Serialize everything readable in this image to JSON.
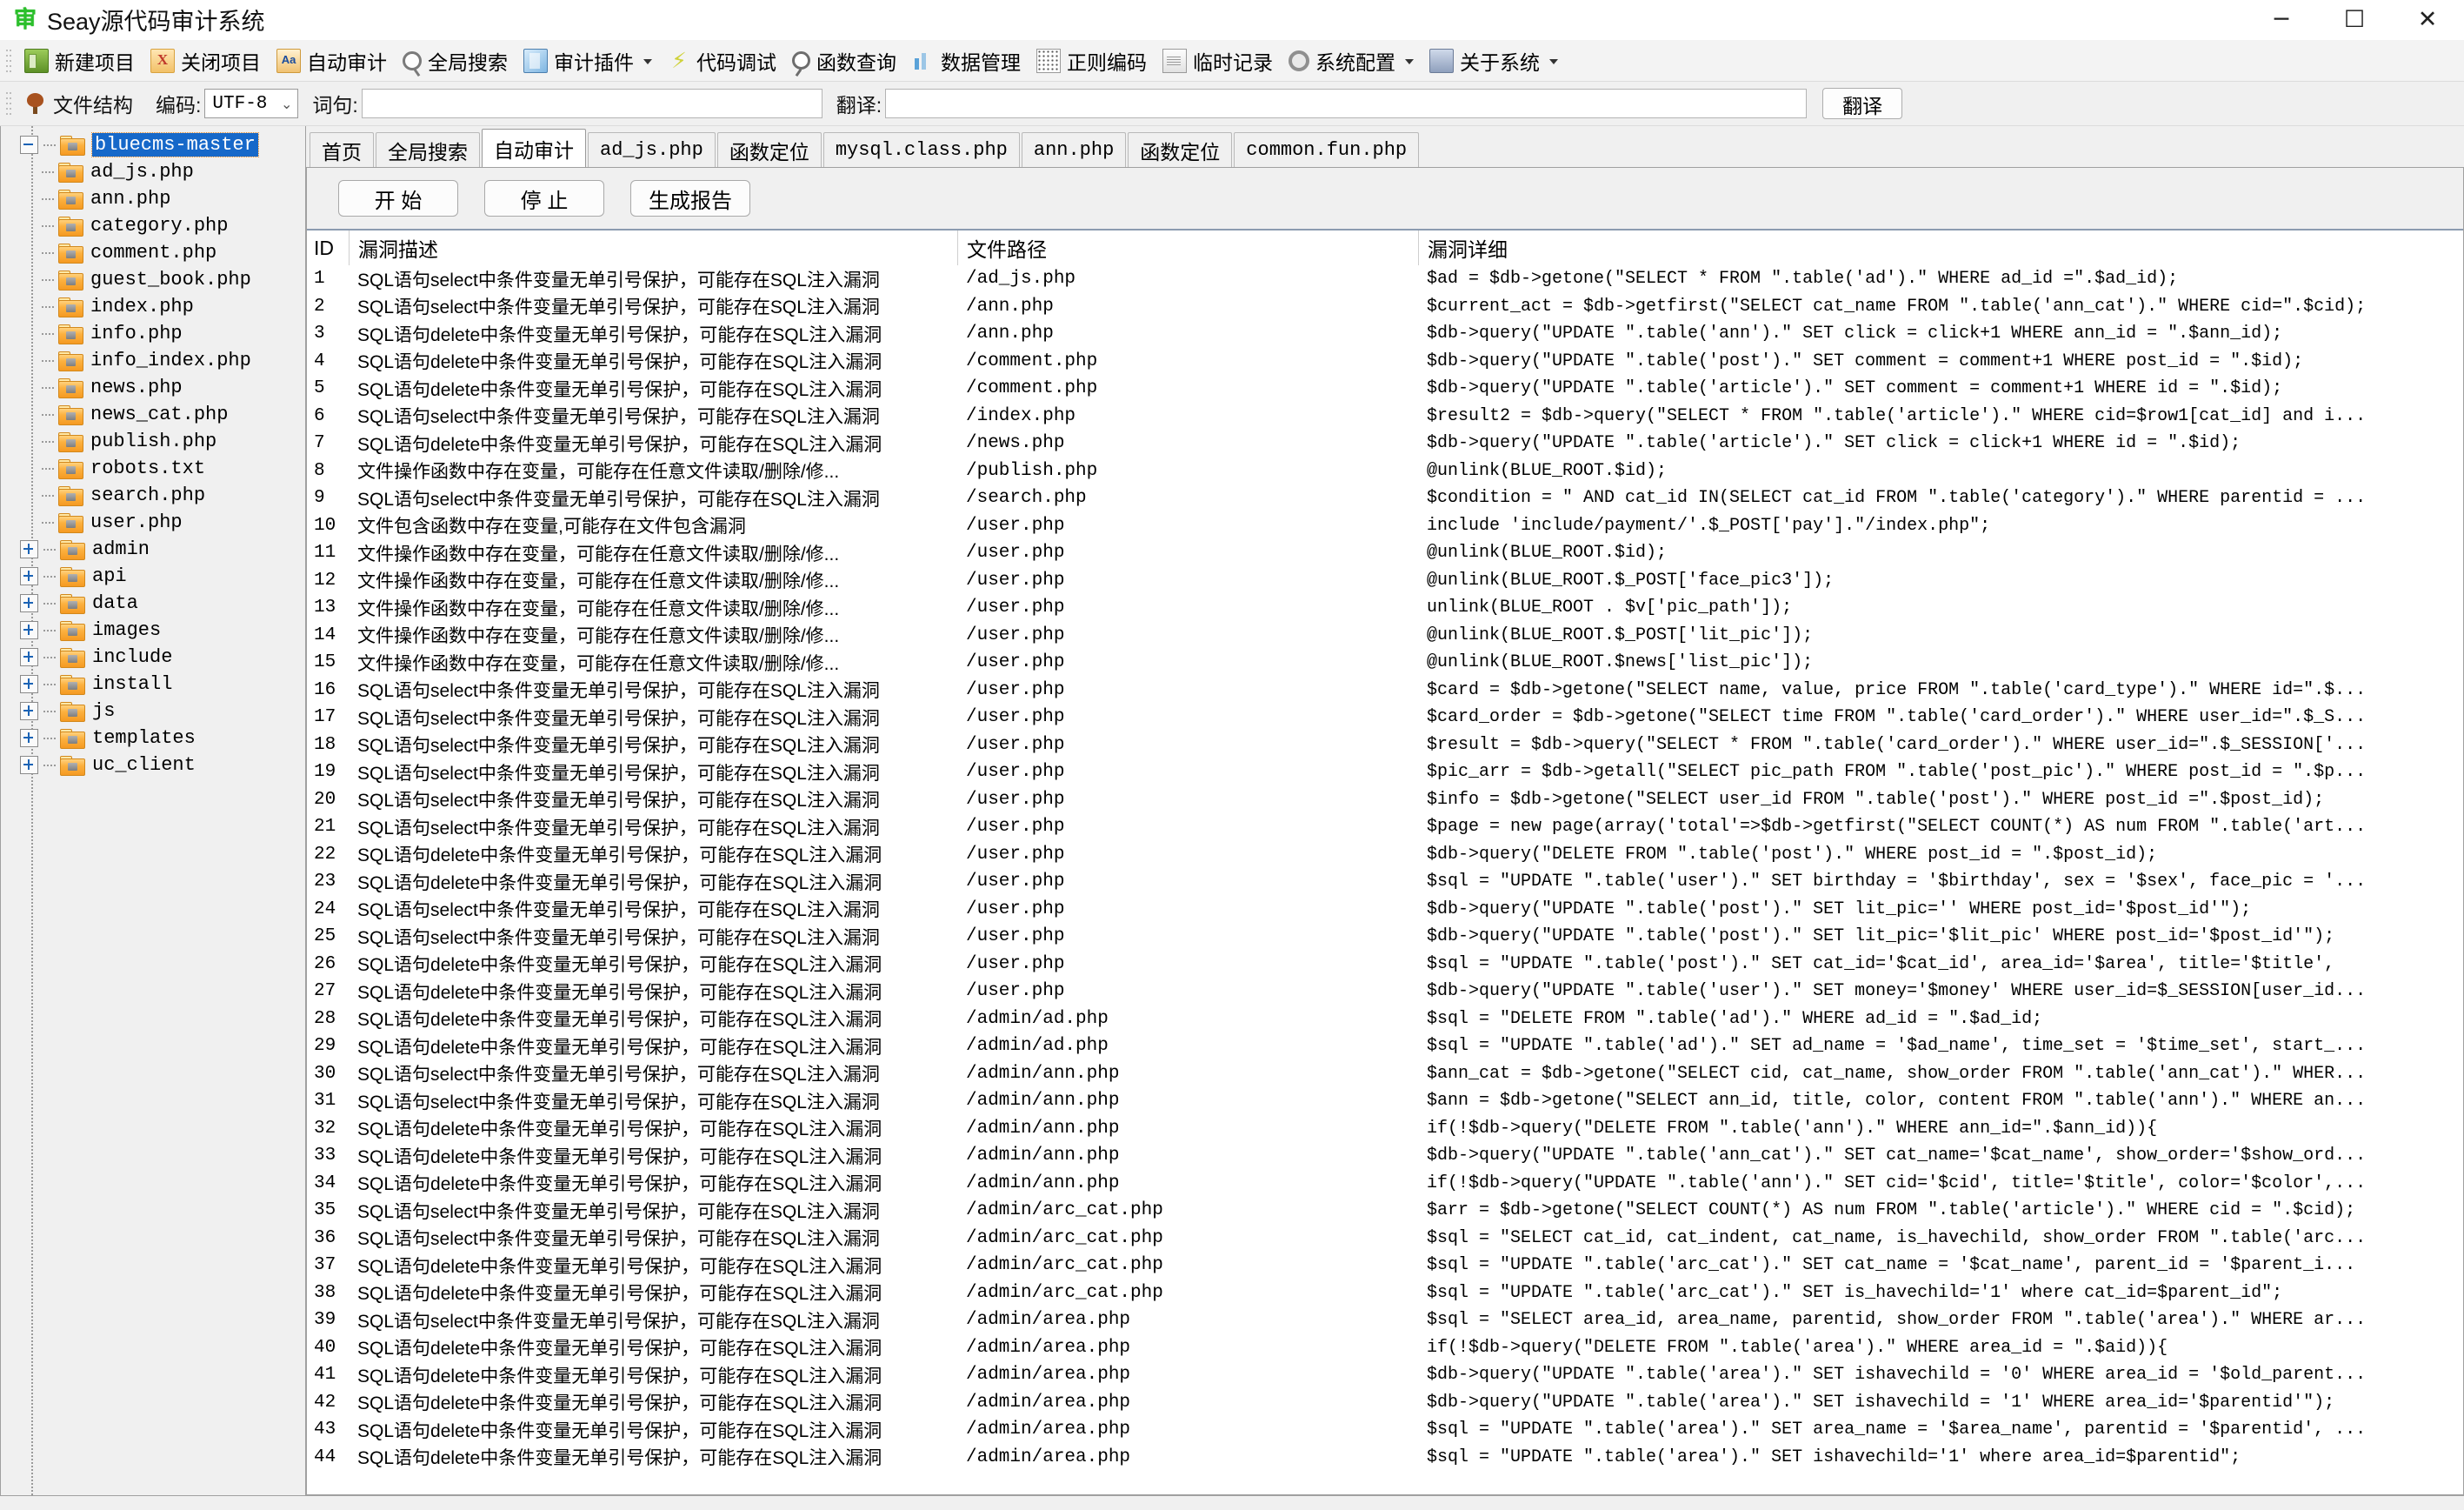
{
  "window": {
    "title": "Seay源代码审计系统",
    "app_icon": "审",
    "minimize": "─",
    "maximize": "☐",
    "close": "✕"
  },
  "toolbar": {
    "items": [
      {
        "label": "新建项目",
        "icon": "new-project-icon",
        "dropdown": false
      },
      {
        "label": "关闭项目",
        "icon": "close-project-icon",
        "dropdown": false
      },
      {
        "label": "自动审计",
        "icon": "auto-audit-icon",
        "dropdown": false
      },
      {
        "label": "全局搜索",
        "icon": "global-search-icon",
        "dropdown": false
      },
      {
        "label": "审计插件",
        "icon": "audit-plugin-icon",
        "dropdown": true
      },
      {
        "label": "代码调试",
        "icon": "code-debug-icon",
        "dropdown": false
      },
      {
        "label": "函数查询",
        "icon": "function-query-icon",
        "dropdown": false
      },
      {
        "label": "数据管理",
        "icon": "data-management-icon",
        "dropdown": false
      },
      {
        "label": "正则编码",
        "icon": "regex-encoding-icon",
        "dropdown": false
      },
      {
        "label": "临时记录",
        "icon": "temp-note-icon",
        "dropdown": false
      },
      {
        "label": "系统配置",
        "icon": "system-config-icon",
        "dropdown": true
      },
      {
        "label": "关于系统",
        "icon": "about-system-icon",
        "dropdown": true
      }
    ]
  },
  "subbar": {
    "file_structure_label": "文件结构",
    "encoding_label": "编码:",
    "encoding_value": "UTF-8",
    "word_label": "词句:",
    "word_value": "",
    "word_placeholder": "",
    "translate_label": "翻译:",
    "translate_value": "",
    "translate_placeholder": "",
    "translate_button": "翻译"
  },
  "tree": {
    "root": {
      "label": "bluecms-master",
      "expanded": true,
      "selected": true
    },
    "children": [
      {
        "label": "ad_js.php",
        "toggle": "none"
      },
      {
        "label": "ann.php",
        "toggle": "none"
      },
      {
        "label": "category.php",
        "toggle": "none"
      },
      {
        "label": "comment.php",
        "toggle": "none"
      },
      {
        "label": "guest_book.php",
        "toggle": "none"
      },
      {
        "label": "index.php",
        "toggle": "none"
      },
      {
        "label": "info.php",
        "toggle": "none"
      },
      {
        "label": "info_index.php",
        "toggle": "none"
      },
      {
        "label": "news.php",
        "toggle": "none"
      },
      {
        "label": "news_cat.php",
        "toggle": "none"
      },
      {
        "label": "publish.php",
        "toggle": "none"
      },
      {
        "label": "robots.txt",
        "toggle": "none"
      },
      {
        "label": "search.php",
        "toggle": "none"
      },
      {
        "label": "user.php",
        "toggle": "none"
      },
      {
        "label": "admin",
        "toggle": "plus"
      },
      {
        "label": "api",
        "toggle": "plus"
      },
      {
        "label": "data",
        "toggle": "plus"
      },
      {
        "label": "images",
        "toggle": "plus"
      },
      {
        "label": "include",
        "toggle": "plus"
      },
      {
        "label": "install",
        "toggle": "plus"
      },
      {
        "label": "js",
        "toggle": "plus"
      },
      {
        "label": "templates",
        "toggle": "plus"
      },
      {
        "label": "uc_client",
        "toggle": "plus"
      }
    ]
  },
  "tabs": [
    {
      "label": "首页",
      "active": false,
      "mono": false
    },
    {
      "label": "全局搜索",
      "active": false,
      "mono": false
    },
    {
      "label": "自动审计",
      "active": true,
      "mono": false
    },
    {
      "label": "ad_js.php",
      "active": false,
      "mono": true
    },
    {
      "label": "函数定位",
      "active": false,
      "mono": false
    },
    {
      "label": "mysql.class.php",
      "active": false,
      "mono": true
    },
    {
      "label": "ann.php",
      "active": false,
      "mono": true
    },
    {
      "label": "函数定位",
      "active": false,
      "mono": false
    },
    {
      "label": "common.fun.php",
      "active": false,
      "mono": true
    }
  ],
  "actions": {
    "start": "开 始",
    "stop": "停 止",
    "report": "生成报告"
  },
  "table": {
    "headers": [
      "ID",
      "漏洞描述",
      "文件路径",
      "漏洞详细"
    ],
    "rows": [
      {
        "id": "1",
        "desc": "SQL语句select中条件变量无单引号保护，可能存在SQL注入漏洞",
        "path": "/ad_js.php",
        "detail": "$ad = $db->getone(\"SELECT * FROM \".table('ad').\" WHERE ad_id =\".$ad_id);"
      },
      {
        "id": "2",
        "desc": "SQL语句select中条件变量无单引号保护，可能存在SQL注入漏洞",
        "path": "/ann.php",
        "detail": "$current_act = $db->getfirst(\"SELECT cat_name FROM \".table('ann_cat').\" WHERE cid=\".$cid);"
      },
      {
        "id": "3",
        "desc": "SQL语句delete中条件变量无单引号保护，可能存在SQL注入漏洞",
        "path": "/ann.php",
        "detail": "$db->query(\"UPDATE \".table('ann').\" SET click = click+1 WHERE ann_id = \".$ann_id);"
      },
      {
        "id": "4",
        "desc": "SQL语句delete中条件变量无单引号保护，可能存在SQL注入漏洞",
        "path": "/comment.php",
        "detail": "$db->query(\"UPDATE \".table('post').\" SET comment = comment+1 WHERE post_id = \".$id);"
      },
      {
        "id": "5",
        "desc": "SQL语句delete中条件变量无单引号保护，可能存在SQL注入漏洞",
        "path": "/comment.php",
        "detail": "$db->query(\"UPDATE \".table('article').\" SET comment = comment+1 WHERE id = \".$id);"
      },
      {
        "id": "6",
        "desc": "SQL语句select中条件变量无单引号保护，可能存在SQL注入漏洞",
        "path": "/index.php",
        "detail": "$result2 = $db->query(\"SELECT * FROM \".table('article').\" WHERE cid=$row1[cat_id] and i..."
      },
      {
        "id": "7",
        "desc": "SQL语句delete中条件变量无单引号保护，可能存在SQL注入漏洞",
        "path": "/news.php",
        "detail": "$db->query(\"UPDATE \".table('article').\" SET click = click+1 WHERE id = \".$id);"
      },
      {
        "id": "8",
        "desc": "文件操作函数中存在变量，可能存在任意文件读取/删除/修...",
        "path": "/publish.php",
        "detail": "@unlink(BLUE_ROOT.$id);"
      },
      {
        "id": "9",
        "desc": "SQL语句select中条件变量无单引号保护，可能存在SQL注入漏洞",
        "path": "/search.php",
        "detail": "$condition = \" AND cat_id IN(SELECT cat_id FROM \".table('category').\" WHERE parentid = ..."
      },
      {
        "id": "10",
        "desc": "文件包含函数中存在变量,可能存在文件包含漏洞",
        "path": "/user.php",
        "detail": "include 'include/payment/'.$_POST['pay'].\"/index.php\";"
      },
      {
        "id": "11",
        "desc": "文件操作函数中存在变量，可能存在任意文件读取/删除/修...",
        "path": "/user.php",
        "detail": "@unlink(BLUE_ROOT.$id);"
      },
      {
        "id": "12",
        "desc": "文件操作函数中存在变量，可能存在任意文件读取/删除/修...",
        "path": "/user.php",
        "detail": "@unlink(BLUE_ROOT.$_POST['face_pic3']);"
      },
      {
        "id": "13",
        "desc": "文件操作函数中存在变量，可能存在任意文件读取/删除/修...",
        "path": "/user.php",
        "detail": "unlink(BLUE_ROOT . $v['pic_path']);"
      },
      {
        "id": "14",
        "desc": "文件操作函数中存在变量，可能存在任意文件读取/删除/修...",
        "path": "/user.php",
        "detail": "@unlink(BLUE_ROOT.$_POST['lit_pic']);"
      },
      {
        "id": "15",
        "desc": "文件操作函数中存在变量，可能存在任意文件读取/删除/修...",
        "path": "/user.php",
        "detail": "@unlink(BLUE_ROOT.$news['list_pic']);"
      },
      {
        "id": "16",
        "desc": "SQL语句select中条件变量无单引号保护，可能存在SQL注入漏洞",
        "path": "/user.php",
        "detail": "$card = $db->getone(\"SELECT name, value, price FROM \".table('card_type').\" WHERE id=\".$..."
      },
      {
        "id": "17",
        "desc": "SQL语句select中条件变量无单引号保护，可能存在SQL注入漏洞",
        "path": "/user.php",
        "detail": "$card_order = $db->getone(\"SELECT time FROM \".table('card_order').\" WHERE user_id=\".$_S..."
      },
      {
        "id": "18",
        "desc": "SQL语句select中条件变量无单引号保护，可能存在SQL注入漏洞",
        "path": "/user.php",
        "detail": "$result = $db->query(\"SELECT * FROM \".table('card_order').\" WHERE user_id=\".$_SESSION['..."
      },
      {
        "id": "19",
        "desc": "SQL语句select中条件变量无单引号保护，可能存在SQL注入漏洞",
        "path": "/user.php",
        "detail": "$pic_arr = $db->getall(\"SELECT pic_path FROM \".table('post_pic').\" WHERE post_id = \".$p..."
      },
      {
        "id": "20",
        "desc": "SQL语句select中条件变量无单引号保护，可能存在SQL注入漏洞",
        "path": "/user.php",
        "detail": "$info = $db->getone(\"SELECT user_id FROM \".table('post').\" WHERE post_id =\".$post_id);"
      },
      {
        "id": "21",
        "desc": "SQL语句select中条件变量无单引号保护，可能存在SQL注入漏洞",
        "path": "/user.php",
        "detail": "$page = new page(array('total'=>$db->getfirst(\"SELECT COUNT(*) AS num FROM \".table('art..."
      },
      {
        "id": "22",
        "desc": "SQL语句delete中条件变量无单引号保护，可能存在SQL注入漏洞",
        "path": "/user.php",
        "detail": "$db->query(\"DELETE FROM \".table('post').\" WHERE post_id = \".$post_id);"
      },
      {
        "id": "23",
        "desc": "SQL语句delete中条件变量无单引号保护，可能存在SQL注入漏洞",
        "path": "/user.php",
        "detail": "$sql = \"UPDATE \".table('user').\" SET birthday = '$birthday', sex = '$sex',  face_pic = '..."
      },
      {
        "id": "24",
        "desc": "SQL语句select中条件变量无单引号保护，可能存在SQL注入漏洞",
        "path": "/user.php",
        "detail": "$db->query(\"UPDATE \".table('post').\" SET lit_pic='' WHERE post_id='$post_id'\");"
      },
      {
        "id": "25",
        "desc": "SQL语句select中条件变量无单引号保护，可能存在SQL注入漏洞",
        "path": "/user.php",
        "detail": "$db->query(\"UPDATE \".table('post').\" SET lit_pic='$lit_pic' WHERE post_id='$post_id'\");"
      },
      {
        "id": "26",
        "desc": "SQL语句delete中条件变量无单引号保护，可能存在SQL注入漏洞",
        "path": "/user.php",
        "detail": "$sql = \"UPDATE \".table('post').\" SET cat_id='$cat_id',  area_id='$area',  title='$title',"
      },
      {
        "id": "27",
        "desc": "SQL语句delete中条件变量无单引号保护，可能存在SQL注入漏洞",
        "path": "/user.php",
        "detail": "$db->query(\"UPDATE \".table('user').\" SET money='$money' WHERE user_id=$_SESSION[user_id..."
      },
      {
        "id": "28",
        "desc": "SQL语句delete中条件变量无单引号保护，可能存在SQL注入漏洞",
        "path": "/admin/ad.php",
        "detail": "$sql = \"DELETE FROM \".table('ad').\" WHERE ad_id = \".$ad_id;"
      },
      {
        "id": "29",
        "desc": "SQL语句delete中条件变量无单引号保护，可能存在SQL注入漏洞",
        "path": "/admin/ad.php",
        "detail": "$sql = \"UPDATE \".table('ad').\" SET ad_name = '$ad_name', time_set = '$time_set',  start_..."
      },
      {
        "id": "30",
        "desc": "SQL语句select中条件变量无单引号保护，可能存在SQL注入漏洞",
        "path": "/admin/ann.php",
        "detail": "$ann_cat = $db->getone(\"SELECT cid, cat_name, show_order FROM \".table('ann_cat').\" WHER..."
      },
      {
        "id": "31",
        "desc": "SQL语句select中条件变量无单引号保护，可能存在SQL注入漏洞",
        "path": "/admin/ann.php",
        "detail": "$ann = $db->getone(\"SELECT ann_id, title, color, content FROM \".table('ann').\" WHERE an..."
      },
      {
        "id": "32",
        "desc": "SQL语句delete中条件变量无单引号保护，可能存在SQL注入漏洞",
        "path": "/admin/ann.php",
        "detail": "if(!$db->query(\"DELETE FROM \".table('ann').\" WHERE ann_id=\".$ann_id)){"
      },
      {
        "id": "33",
        "desc": "SQL语句delete中条件变量无单引号保护，可能存在SQL注入漏洞",
        "path": "/admin/ann.php",
        "detail": "$db->query(\"UPDATE \".table('ann_cat').\" SET cat_name='$cat_name', show_order='$show_ord..."
      },
      {
        "id": "34",
        "desc": "SQL语句delete中条件变量无单引号保护，可能存在SQL注入漏洞",
        "path": "/admin/ann.php",
        "detail": "if(!$db->query(\"UPDATE \".table('ann').\" SET cid='$cid', title='$title', color='$color',..."
      },
      {
        "id": "35",
        "desc": "SQL语句select中条件变量无单引号保护，可能存在SQL注入漏洞",
        "path": "/admin/arc_cat.php",
        "detail": "$arr = $db->getone(\"SELECT COUNT(*) AS num FROM \".table('article').\" WHERE cid = \".$cid);"
      },
      {
        "id": "36",
        "desc": "SQL语句select中条件变量无单引号保护，可能存在SQL注入漏洞",
        "path": "/admin/arc_cat.php",
        "detail": "$sql = \"SELECT cat_id, cat_indent, cat_name, is_havechild, show_order FROM \".table('arc..."
      },
      {
        "id": "37",
        "desc": "SQL语句delete中条件变量无单引号保护，可能存在SQL注入漏洞",
        "path": "/admin/arc_cat.php",
        "detail": "$sql = \"UPDATE \".table('arc_cat').\" SET cat_name = '$cat_name',  parent_id = '$parent_i..."
      },
      {
        "id": "38",
        "desc": "SQL语句delete中条件变量无单引号保护，可能存在SQL注入漏洞",
        "path": "/admin/arc_cat.php",
        "detail": "$sql = \"UPDATE \".table('arc_cat').\" SET is_havechild='1' where cat_id=$parent_id\";"
      },
      {
        "id": "39",
        "desc": "SQL语句select中条件变量无单引号保护，可能存在SQL注入漏洞",
        "path": "/admin/area.php",
        "detail": "$sql = \"SELECT area_id, area_name, parentid, show_order FROM \".table('area').\" WHERE ar..."
      },
      {
        "id": "40",
        "desc": "SQL语句delete中条件变量无单引号保护，可能存在SQL注入漏洞",
        "path": "/admin/area.php",
        "detail": "if(!$db->query(\"DELETE FROM \".table('area').\" WHERE area_id = \".$aid)){"
      },
      {
        "id": "41",
        "desc": "SQL语句delete中条件变量无单引号保护，可能存在SQL注入漏洞",
        "path": "/admin/area.php",
        "detail": "$db->query(\"UPDATE \".table('area').\" SET ishavechild = '0' WHERE area_id = '$old_parent..."
      },
      {
        "id": "42",
        "desc": "SQL语句delete中条件变量无单引号保护，可能存在SQL注入漏洞",
        "path": "/admin/area.php",
        "detail": "$db->query(\"UPDATE \".table('area').\" SET ishavechild = '1' WHERE area_id='$parentid'\");"
      },
      {
        "id": "43",
        "desc": "SQL语句delete中条件变量无单引号保护，可能存在SQL注入漏洞",
        "path": "/admin/area.php",
        "detail": "$sql = \"UPDATE \".table('area').\" SET area_name = '$area_name', parentid = '$parentid',  ..."
      },
      {
        "id": "44",
        "desc": "SQL语句delete中条件变量无单引号保护，可能存在SQL注入漏洞",
        "path": "/admin/area.php",
        "detail": "$sql = \"UPDATE \".table('area').\" SET ishavechild='1' where area_id=$parentid\";"
      }
    ]
  },
  "colors": {
    "selection_blue": "#1668c9",
    "folder_orange": "#f59a22",
    "toolbar_bg": "#f3f3f3",
    "panel_bg": "#f0f0f0"
  }
}
